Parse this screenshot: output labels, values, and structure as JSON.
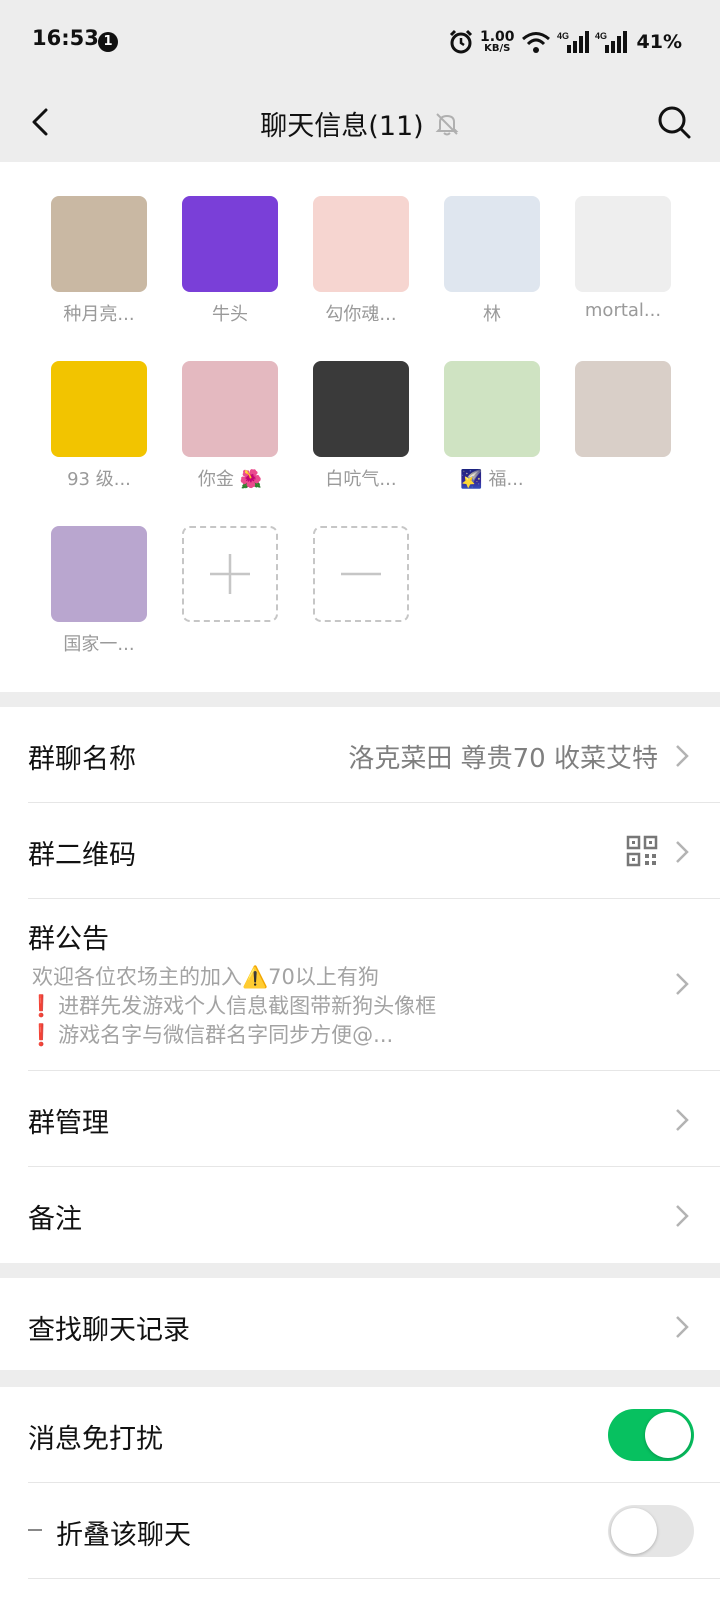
{
  "status_bar": {
    "time": "16:53",
    "notification_count": "1",
    "net_speed": "1.00",
    "net_unit": "KB/S",
    "battery": "41%"
  },
  "nav": {
    "title": "聊天信息(11)",
    "icons": [
      "back-icon",
      "bell-mute-icon",
      "search-icon"
    ]
  },
  "members": [
    {
      "name": "种月亮...",
      "avatar_color": "#c9b8a3"
    },
    {
      "name": "牛头",
      "avatar_color": "#7a3fd8"
    },
    {
      "name": "勾你魂...",
      "avatar_color": "#f6d5d0"
    },
    {
      "name": "林",
      "avatar_color": "#dfe6ef"
    },
    {
      "name": "mortal...",
      "avatar_color": "#eeeeee"
    },
    {
      "name": "93 级...",
      "avatar_color": "#f2c400"
    },
    {
      "name": "你金 🌺",
      "avatar_color": "#e4b9c0"
    },
    {
      "name": "白吭气...",
      "avatar_color": "#3a3a3a"
    },
    {
      "name": "🌠 福...",
      "avatar_color": "#cfe3c2"
    },
    {
      "name": "",
      "avatar_color": "#d9cfc8"
    },
    {
      "name": "国家一...",
      "avatar_color": "#b9a6cf"
    }
  ],
  "group": {
    "name_label": "群聊名称",
    "name_value": "洛克菜田 尊贵70 收菜艾特",
    "qr_label": "群二维码",
    "notice_label": "群公告",
    "notice_lines": [
      {
        "mark": "",
        "text": "欢迎各位农场主的加入⚠️70以上有狗"
      },
      {
        "mark": "❗",
        "text": "进群先发游戏个人信息截图带新狗头像框"
      },
      {
        "mark": "❗",
        "text": "游戏名字与微信群名字同步方便@..."
      }
    ],
    "manage_label": "群管理",
    "remark_label": "备注"
  },
  "history": {
    "search_label": "查找聊天记录"
  },
  "settings": {
    "mute_label": "消息免打扰",
    "mute_on": true,
    "fold_label": "折叠该聊天",
    "fold_on": false
  },
  "colors": {
    "accent_green": "#07c160",
    "background": "#ededed"
  }
}
